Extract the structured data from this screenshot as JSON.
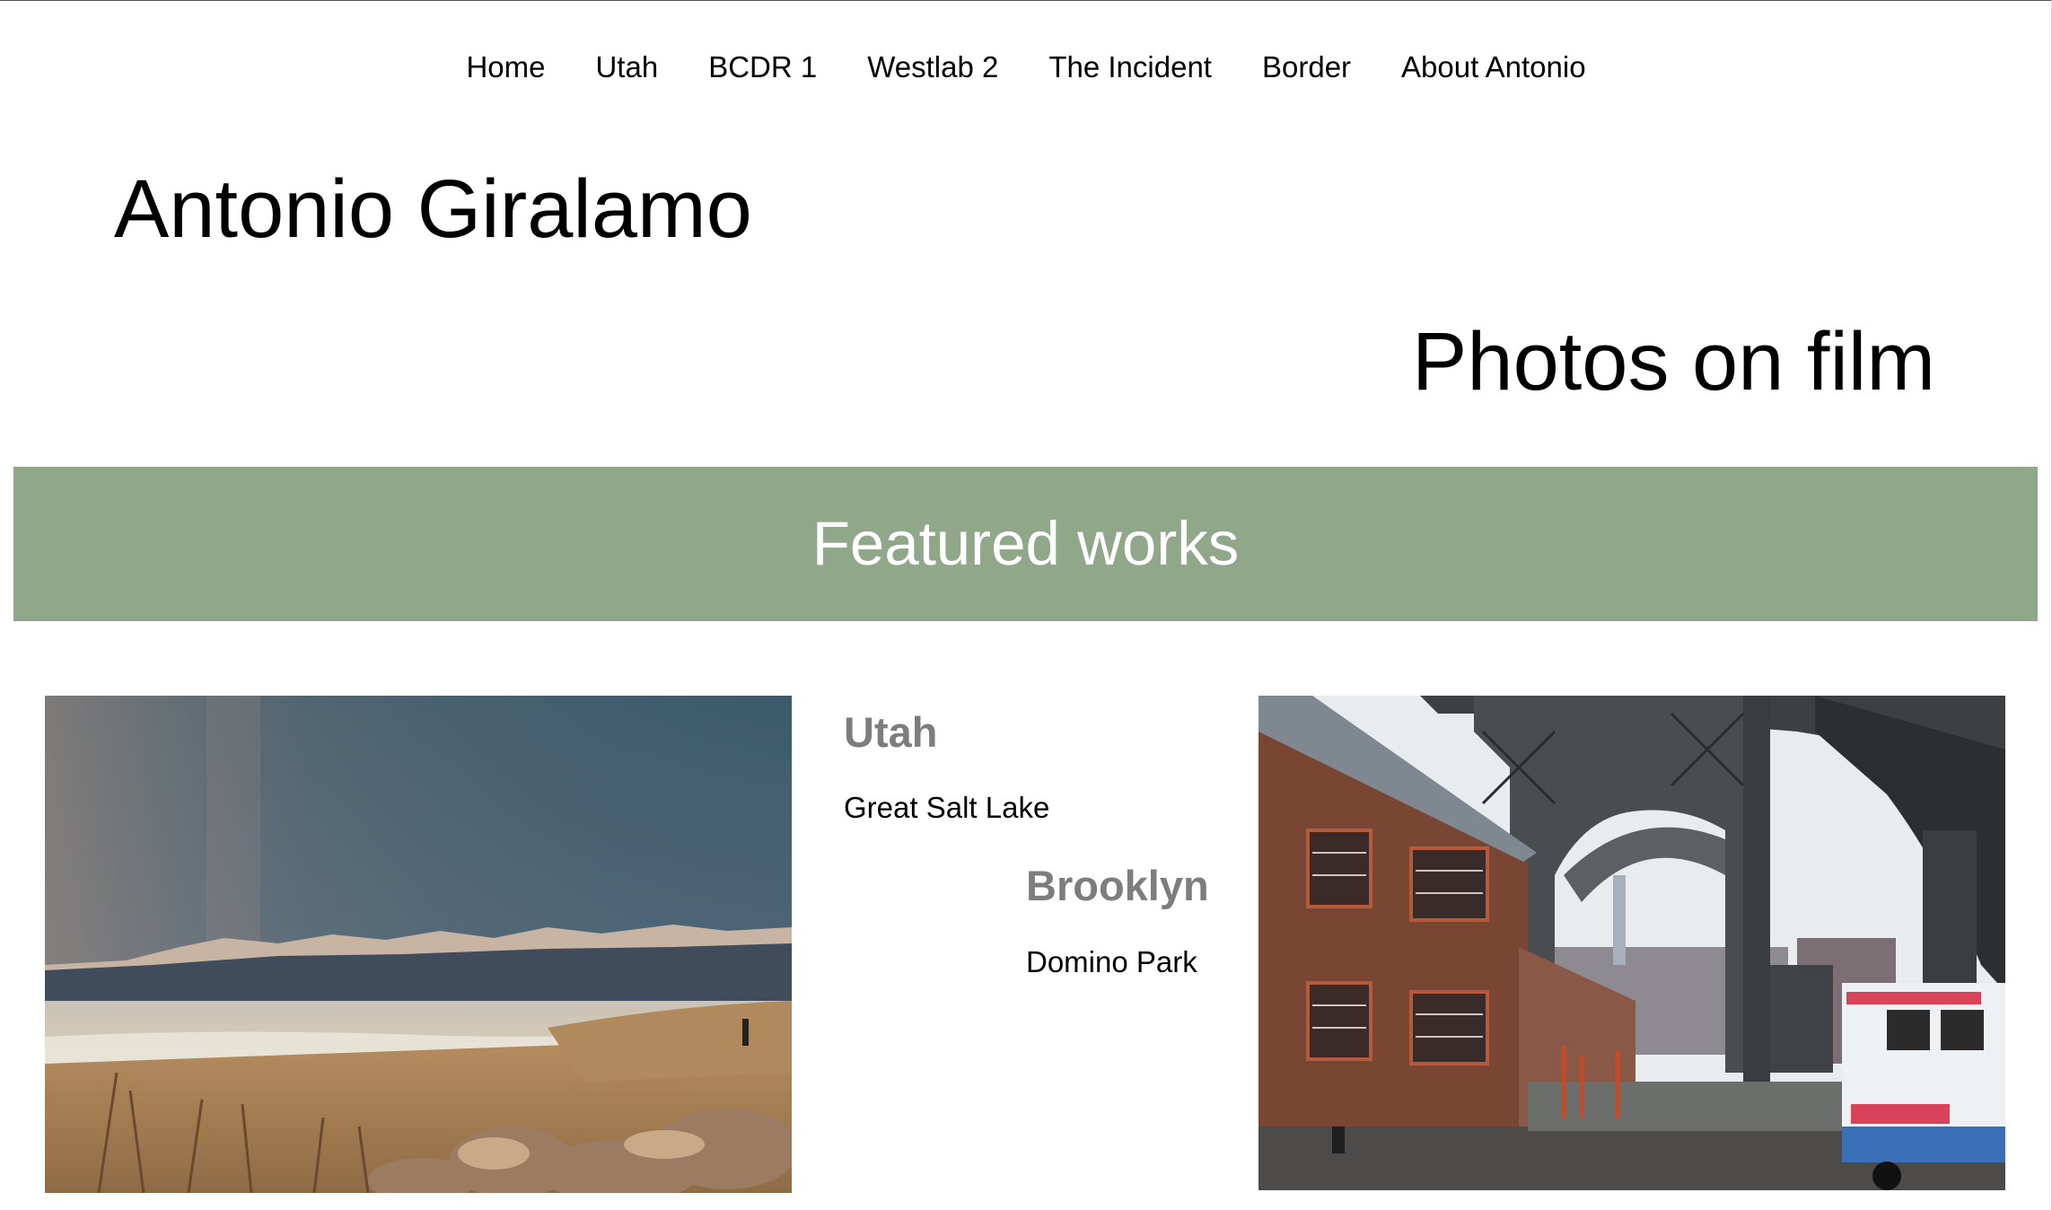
{
  "nav": {
    "items": [
      {
        "label": "Home"
      },
      {
        "label": "Utah"
      },
      {
        "label": "BCDR 1"
      },
      {
        "label": "Westlab 2"
      },
      {
        "label": "The Incident"
      },
      {
        "label": "Border"
      },
      {
        "label": "About Antonio"
      }
    ]
  },
  "header": {
    "title": "Antonio Giralamo",
    "tagline": "Photos on film"
  },
  "featured": {
    "heading": "Featured works",
    "band_color": "#91a78a",
    "works": [
      {
        "title": "Utah",
        "subtitle": "Great Salt Lake",
        "photo": "great-salt-lake-photo"
      },
      {
        "title": "Brooklyn",
        "subtitle": "Domino Park",
        "photo": "williamsburg-bridge-photo"
      }
    ]
  },
  "colors": {
    "caption_title": "#7d7d7d",
    "heading_text": "#ffffff"
  }
}
